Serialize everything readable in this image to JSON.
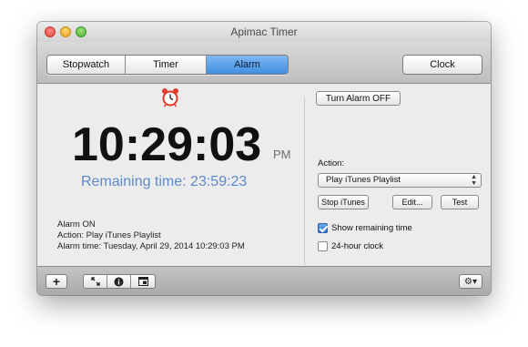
{
  "window": {
    "title": "Apimac Timer"
  },
  "toolbar": {
    "tabs": [
      {
        "label": "Stopwatch",
        "active": false
      },
      {
        "label": "Timer",
        "active": false
      },
      {
        "label": "Alarm",
        "active": true
      }
    ],
    "clock_label": "Clock"
  },
  "alarm": {
    "icon": "alarm-clock-icon",
    "time": "10:29:03",
    "ampm": "PM",
    "remaining": "Remaining time: 23:59:23",
    "status_lines": [
      "Alarm ON",
      "Action: Play iTunes Playlist",
      "Alarm time: Tuesday, April 29, 2014 10:29:03 PM"
    ]
  },
  "controls": {
    "turn_off_label": "Turn Alarm OFF",
    "action_label": "Action:",
    "action_value": "Play iTunes Playlist",
    "stop_itunes_label": "Stop iTunes",
    "edit_label": "Edit...",
    "test_label": "Test",
    "show_remaining_label": "Show remaining time",
    "show_remaining_checked": true,
    "clock24_label": "24-hour clock",
    "clock24_checked": false
  },
  "footer": {
    "add_icon": "plus-icon",
    "resize_icon": "resize-icon",
    "info_icon": "info-icon",
    "window_icon": "window-icon",
    "settings_icon": "gear-icon"
  },
  "colors": {
    "accent": "#5f8ac8",
    "alarm_icon": "#e23a2e",
    "active_tab": "#4c97e6"
  }
}
